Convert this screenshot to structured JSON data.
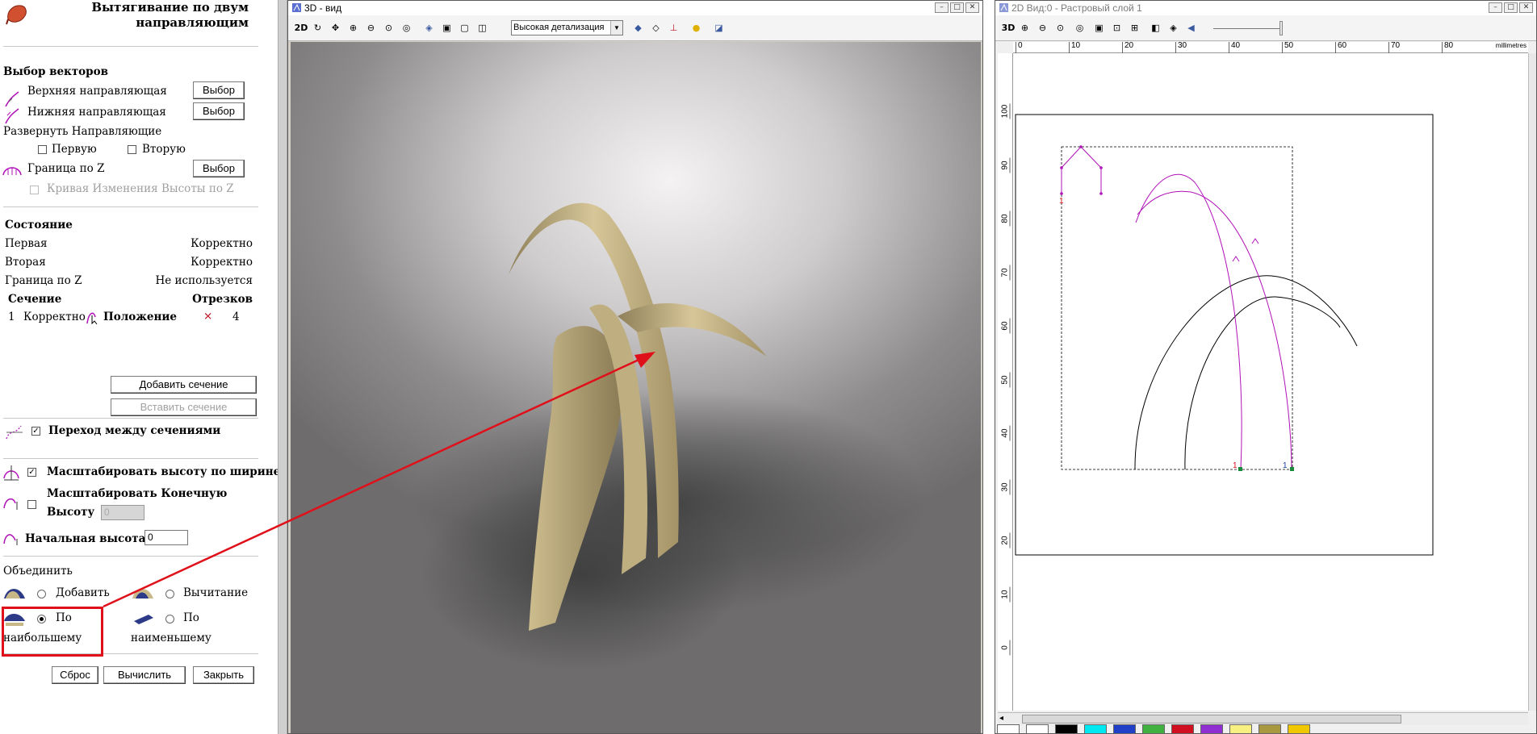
{
  "left_panel": {
    "title_line1": "Вытягивание по двум",
    "title_line2": "направляющим",
    "vectors": {
      "title": "Выбор векторов",
      "top_rail": "Верхняя направляющая",
      "bottom_rail": "Нижняя направляющая",
      "select_label": "Выбор",
      "flip_title": "Развернуть Направляющие",
      "first": "Первую",
      "second": "Вторую",
      "z_bound": "Граница по Z",
      "z_curve": "Кривая Изменения Высоты по Z"
    },
    "state": {
      "title": "Состояние",
      "rows": [
        {
          "label": "Первая",
          "value": "Корректно"
        },
        {
          "label": "Вторая",
          "value": "Корректно"
        },
        {
          "label": "Граница по Z",
          "value": "Не используется"
        }
      ],
      "col_section": "Сечение",
      "col_segments": "Отрезков",
      "section_row": {
        "index": "1",
        "status": "Корректно",
        "position": "Положение",
        "segments": "4"
      }
    },
    "add_section": "Добавить сечение",
    "insert_section": "Вставить сечение",
    "transition": "Переход между сечениями",
    "scale_height": "Масштабировать высоту по ширине",
    "scale_end_line1": "Масштабировать Конечную",
    "scale_end_line2": "Высоту",
    "scale_end_value": "0",
    "start_height": "Начальная высота",
    "start_height_value": "0",
    "combine": {
      "title": "Объединить",
      "add": "Добавить",
      "subtract": "Вычитание",
      "max_line1": "По",
      "max_line2": "наибольшему",
      "min_line1": "По",
      "min_line2": "наименьшему"
    },
    "buttons": {
      "reset": "Сброс",
      "calculate": "Вычислить",
      "close": "Закрыть"
    }
  },
  "view3d": {
    "title": "3D - вид",
    "mode": "2D",
    "detail": "Высокая детализация"
  },
  "view2d": {
    "title": "2D Вид:0 - Растровый слой 1",
    "mode": "3D",
    "units": "millimetres",
    "ruler_x": [
      "0",
      "10",
      "20",
      "30",
      "40",
      "50",
      "60",
      "70",
      "80"
    ],
    "ruler_y": [
      "100",
      "90",
      "80",
      "70",
      "60",
      "50",
      "40",
      "30",
      "20",
      "10",
      "0"
    ],
    "node_labels": [
      "1",
      "1",
      "1"
    ]
  },
  "colors": {
    "accent_red": "#e0101a",
    "curve_magenta": "#b012b8",
    "wood": "#c9b887",
    "palette": [
      "#ffffff",
      "#ffffff",
      "#000000",
      "#00e8f0",
      "#2040c8",
      "#40b040",
      "#d01020",
      "#9030d0",
      "#f8f080",
      "#a89840",
      "#f0c800"
    ]
  }
}
